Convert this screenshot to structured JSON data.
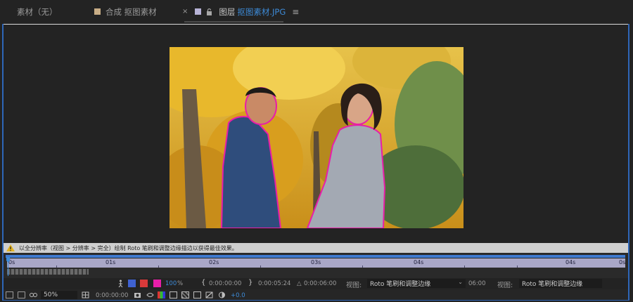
{
  "tabs": {
    "footage": "素材（无）",
    "composition": "合成 抠图素材",
    "layer_label": "图层",
    "layer_name": "抠图素材.JPG",
    "close": "×",
    "menu": "≡"
  },
  "status_message": "以全分辨率（视图 > 分辨率 > 完全）绘制 Roto 笔刷和调整边缘描边以获得最佳效果。",
  "timeline": {
    "ruler_labels": [
      "0s",
      "01s",
      "02s",
      "03s",
      "04s",
      "04s",
      "0s"
    ]
  },
  "controls": {
    "opacity_value": "100",
    "opacity_unit": "%",
    "bracket_in": "{",
    "in_time": "0:00:00:00",
    "bracket_out": "}",
    "out_time": "0:00:05:24",
    "delta_symbol": "△",
    "duration": "0:00:06:00",
    "view_label": "视图:",
    "view_value": "Roto 笔刷和调整边缘",
    "time_short": "06:00",
    "view_label_2": "视图:",
    "view_value_2": "Roto 笔刷和调整边缘"
  },
  "bottom_bar": {
    "zoom": "50%",
    "current_time": "0:00:00:00",
    "exposure": "+0.0"
  },
  "colors": {
    "accent_blue": "#3d8bd8",
    "panel_border": "#2e66b8",
    "ruler": "#a9a7c7",
    "matte_magenta": "#e81ea8"
  }
}
